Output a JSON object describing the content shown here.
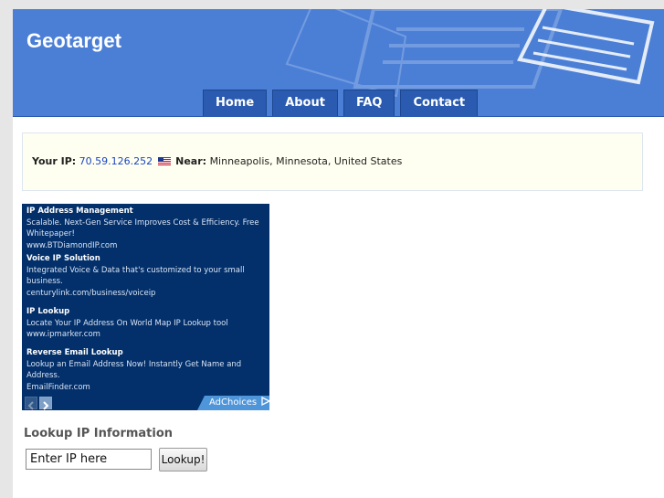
{
  "site": {
    "title": "Geotarget"
  },
  "nav": [
    {
      "label": "Home"
    },
    {
      "label": "About"
    },
    {
      "label": "FAQ"
    },
    {
      "label": "Contact"
    }
  ],
  "ip_info": {
    "your_ip_label": "Your IP:",
    "ip_address": "70.59.126.252",
    "flag_icon": "us-flag-icon",
    "near_label": "Near:",
    "location": "Minneapolis, Minnesota, United States"
  },
  "ad": {
    "items": [
      {
        "title": "IP Address Management",
        "desc": "Scalable. Next-Gen Service Improves Cost & Efficiency. Free Whitepaper!",
        "url": "www.BTDiamondIP.com"
      },
      {
        "title": "Voice IP Solution",
        "desc": "Integrated Voice & Data that's customized to your small business.",
        "url": "centurylink.com/business/voiceip"
      },
      {
        "title": "IP Lookup",
        "desc": "Locate Your IP Address On World Map IP Lookup tool",
        "url": "www.ipmarker.com"
      },
      {
        "title": "Reverse Email Lookup",
        "desc": "Lookup an Email Address Now! Instantly Get Name and Address.",
        "url": "EmailFinder.com"
      }
    ],
    "adchoices_label": "AdChoices"
  },
  "lookup": {
    "heading": "Lookup IP Information",
    "input_value": "Enter IP here",
    "button_label": "Lookup!"
  },
  "colors": {
    "header": "#4b7fd6",
    "nav_tab": "#2a5bb0",
    "ad_bg": "#03306a",
    "ip_box_bg": "#fffff1"
  }
}
